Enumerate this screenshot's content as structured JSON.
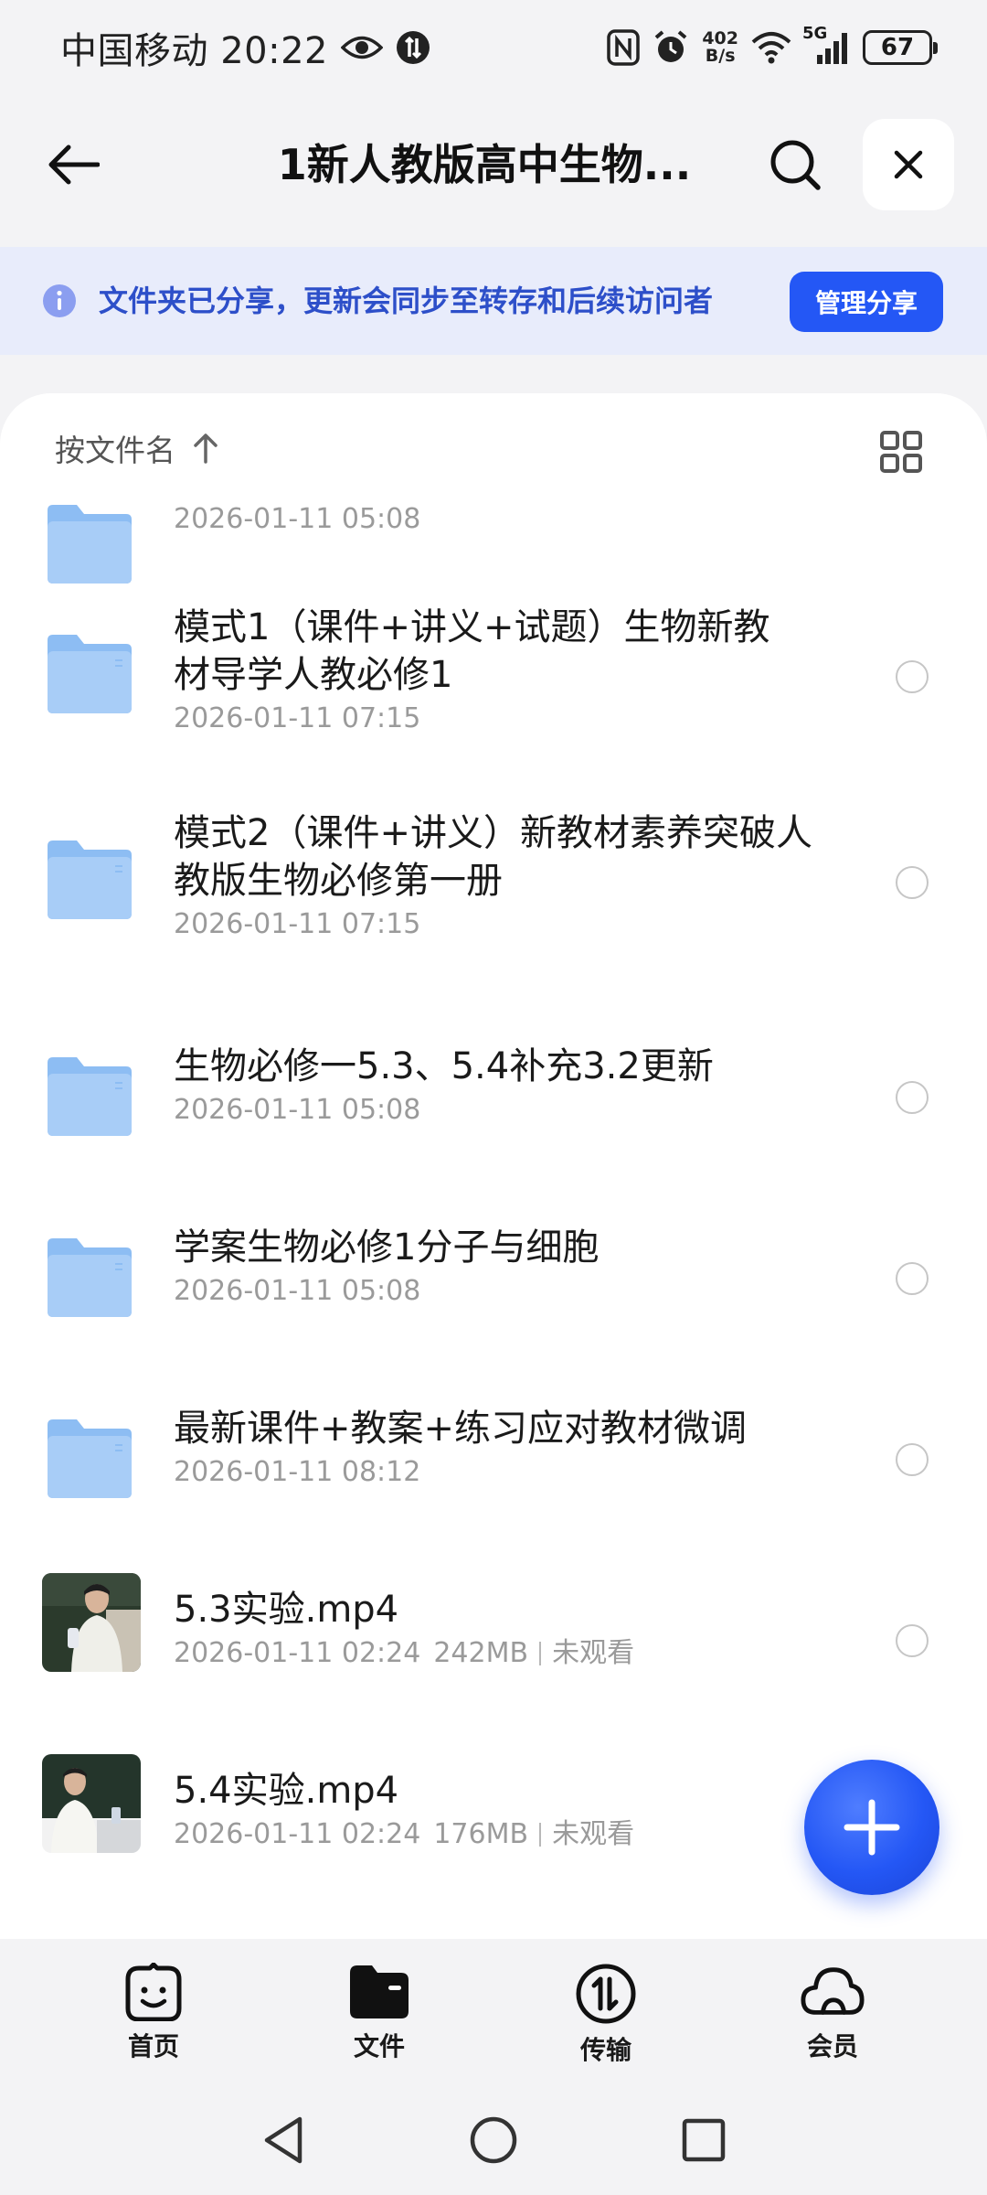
{
  "status_bar": {
    "carrier_time": "中国移动 20:22",
    "net_speed_value": "402",
    "net_speed_unit": "B/s",
    "network_label": "5G",
    "battery": "67"
  },
  "header": {
    "title": "1新人教版高中生物..."
  },
  "banner": {
    "text": "文件夹已分享，更新会同步至转存和后续访问者",
    "button_label": "管理分享"
  },
  "sort": {
    "label": "按文件名"
  },
  "partial_row": {
    "meta": "2026-01-11 05:08"
  },
  "items": [
    {
      "type": "folder",
      "name": "模式1（课件+讲义+试题）生物新教材导学人教必修1",
      "date": "2026-01-11 07:15"
    },
    {
      "type": "folder",
      "name": "模式2（课件+讲义）新教材素养突破人教版生物必修第一册",
      "date": "2026-01-11 07:15"
    },
    {
      "type": "folder",
      "name": "生物必修一5.3、5.4补充3.2更新",
      "date": "2026-01-11 05:08"
    },
    {
      "type": "folder",
      "name": "学案生物必修1分子与细胞",
      "date": "2026-01-11 05:08"
    },
    {
      "type": "folder",
      "name": "最新课件+教案+练习应对教材微调",
      "date": "2026-01-11 08:12"
    },
    {
      "type": "video",
      "name": "5.3实验.mp4",
      "date": "2026-01-11 02:24",
      "size": "242MB",
      "status": "未观看"
    },
    {
      "type": "video",
      "name": "5.4实验.mp4",
      "date": "2026-01-11 02:24",
      "size": "176MB",
      "status": "未观看"
    }
  ],
  "bottom_nav": [
    {
      "label": "首页",
      "icon": "home-face-icon"
    },
    {
      "label": "文件",
      "icon": "folder-icon"
    },
    {
      "label": "传输",
      "icon": "transfer-icon"
    },
    {
      "label": "会员",
      "icon": "cloud-icon"
    }
  ],
  "colors": {
    "accent": "#2457f5",
    "banner_bg": "#e8ecfb",
    "banner_text": "#2d4fc9",
    "folder": "#8dbdf3"
  }
}
